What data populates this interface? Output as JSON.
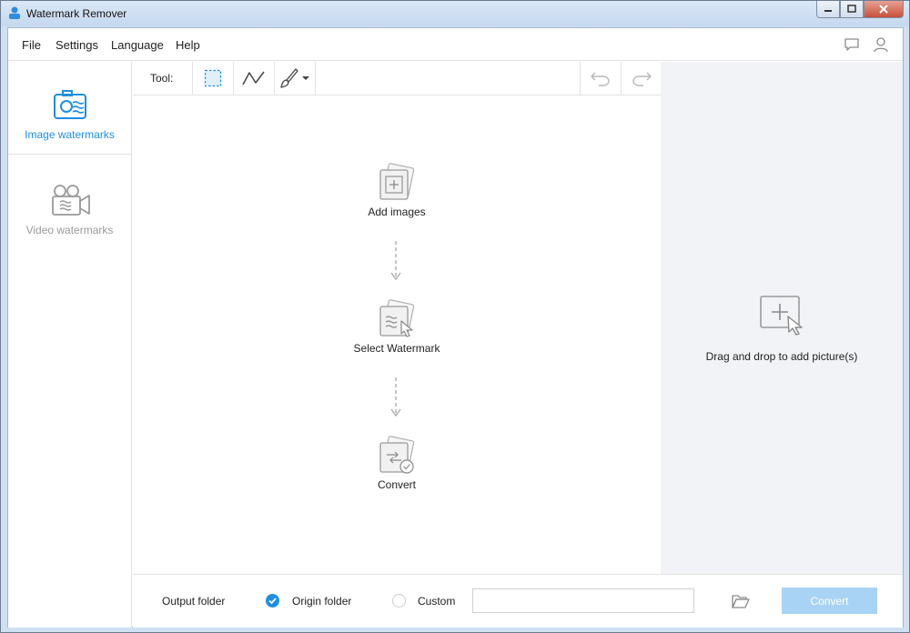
{
  "window": {
    "title": "Watermark Remover"
  },
  "menu": {
    "file": "File",
    "settings": "Settings",
    "language": "Language",
    "help": "Help"
  },
  "sidebar": {
    "items": [
      {
        "label": "Image watermarks",
        "icon": "camera-icon",
        "active": true
      },
      {
        "label": "Video watermarks",
        "icon": "video-camera-icon",
        "active": false
      }
    ]
  },
  "toolbar": {
    "label": "Tool:",
    "tools": [
      "rectangle-select-icon",
      "polyline-icon",
      "brush-icon"
    ],
    "history": [
      "undo-icon",
      "redo-icon"
    ]
  },
  "steps": [
    {
      "label": "Add images",
      "icon": "add-image-icon"
    },
    {
      "label": "Select Watermark",
      "icon": "select-watermark-icon"
    },
    {
      "label": "Convert",
      "icon": "convert-icon"
    }
  ],
  "dropzone": {
    "label": "Drag and drop to add picture(s)"
  },
  "footer": {
    "output_folder_label": "Output folder",
    "origin_folder_label": "Origin folder",
    "custom_label": "Custom",
    "path_value": "",
    "convert_label": "Convert"
  },
  "colors": {
    "accent": "#1f8fe0",
    "convert_disabled": "#a9d3f4",
    "dropzone_bg": "#f2f3f6"
  }
}
